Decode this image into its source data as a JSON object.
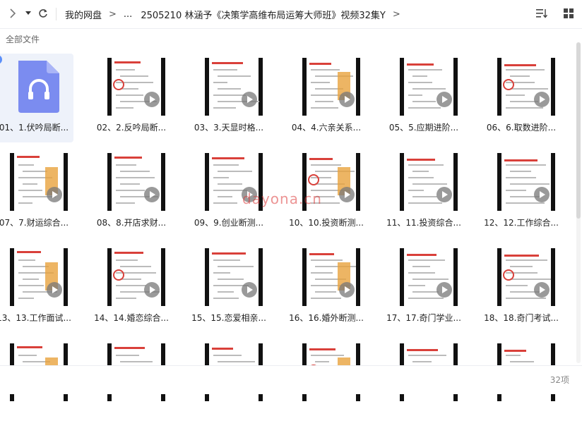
{
  "breadcrumb": {
    "root": "我的网盘",
    "ellipsis": "...",
    "folder": "2505210 林涵予《决策学高维布局运筹大师班》视频32集Y"
  },
  "section_title": "全部文件",
  "files": [
    {
      "name": "01、1.伏吟局断...",
      "type": "audio",
      "selected": true
    },
    {
      "name": "02、2.反吟局断...",
      "type": "video"
    },
    {
      "name": "03、3.天显时格...",
      "type": "video"
    },
    {
      "name": "04、4.六亲关系...",
      "type": "video"
    },
    {
      "name": "05、5.应期进阶...",
      "type": "video"
    },
    {
      "name": "06、6.取数进阶...",
      "type": "video"
    },
    {
      "name": "07、7.财运综合...",
      "type": "video"
    },
    {
      "name": "08、8.开店求财...",
      "type": "video"
    },
    {
      "name": "09、9.创业断测...",
      "type": "video"
    },
    {
      "name": "10、10.投资断测...",
      "type": "video"
    },
    {
      "name": "11、11.投资综合...",
      "type": "video"
    },
    {
      "name": "12、12.工作综合...",
      "type": "video"
    },
    {
      "name": "13、13.工作面试...",
      "type": "video"
    },
    {
      "name": "14、14.婚恋综合...",
      "type": "video"
    },
    {
      "name": "15、15.恋爱相亲...",
      "type": "video"
    },
    {
      "name": "16、16.婚外断测...",
      "type": "video"
    },
    {
      "name": "17、17.奇门学业...",
      "type": "video"
    },
    {
      "name": "18、18.奇门考试...",
      "type": "video"
    },
    {
      "name": "",
      "type": "video"
    },
    {
      "name": "",
      "type": "video"
    },
    {
      "name": "",
      "type": "video"
    },
    {
      "name": "",
      "type": "video"
    },
    {
      "name": "",
      "type": "video"
    },
    {
      "name": "",
      "type": "video"
    }
  ],
  "footer": {
    "count": "32项"
  },
  "watermark": "dayona.cn",
  "colors": {
    "accent": "#5b8ff9",
    "audio_icon": "#7b8cf0",
    "slide_red": "#d9403a"
  }
}
